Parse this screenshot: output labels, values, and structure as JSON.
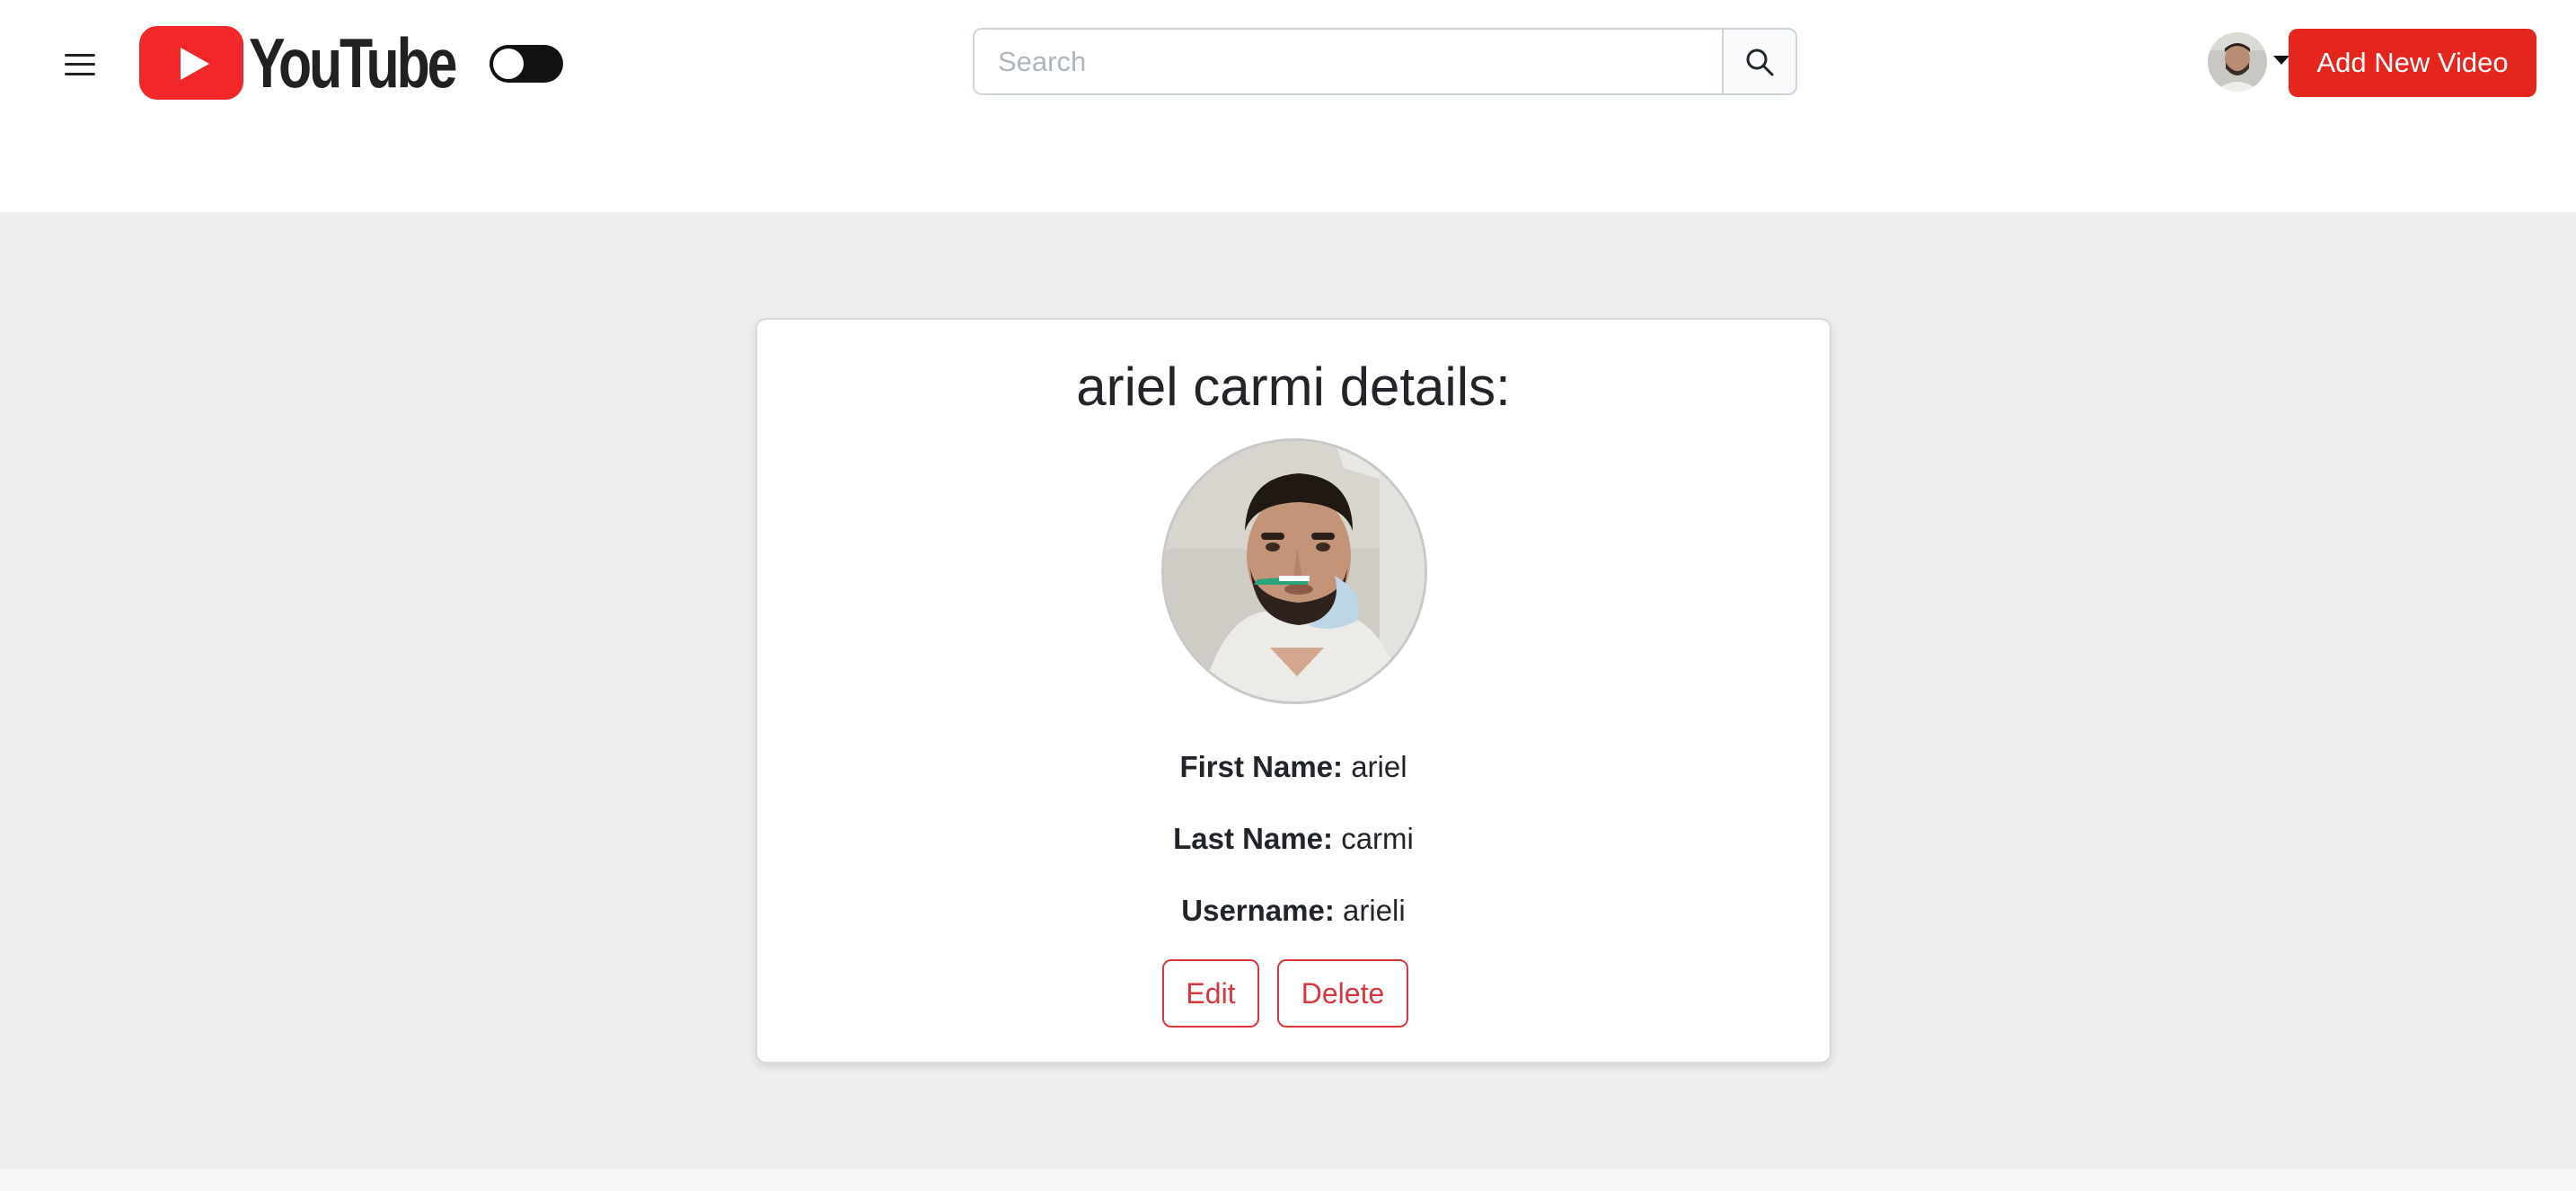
{
  "header": {
    "logo_text": "YouTube",
    "search_placeholder": "Search",
    "search_value": "",
    "add_video_label": "Add New Video",
    "dark_mode_toggle": "off"
  },
  "user_card": {
    "title": "ariel carmi details:",
    "fields": [
      {
        "label": "First Name:",
        "value": "ariel"
      },
      {
        "label": "Last Name:",
        "value": "carmi"
      },
      {
        "label": "Username:",
        "value": "arieli"
      }
    ],
    "edit_label": "Edit",
    "delete_label": "Delete"
  },
  "colors": {
    "brand_red": "#e5261f",
    "danger_outline": "#d9363e",
    "page_background": "#efefef"
  },
  "icons": [
    "menu-icon",
    "youtube-logo-icon",
    "search-icon",
    "caret-down-icon"
  ]
}
